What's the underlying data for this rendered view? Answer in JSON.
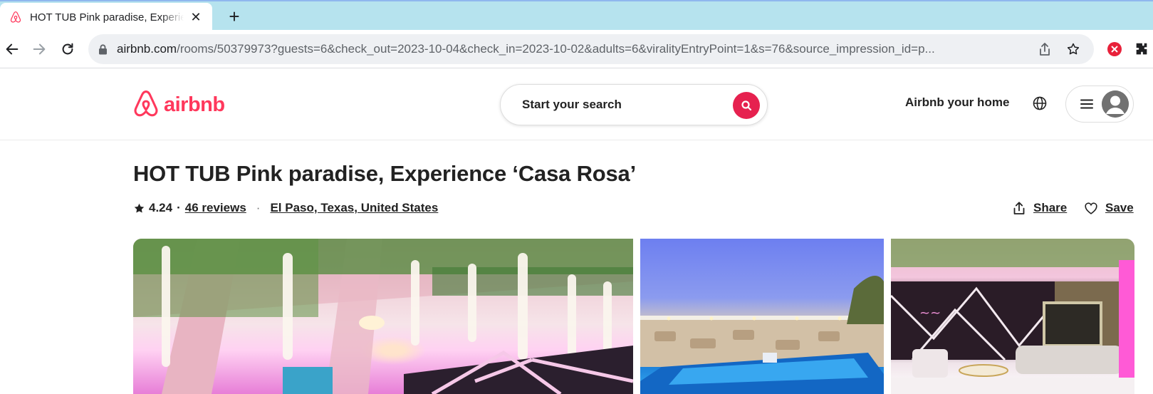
{
  "browser": {
    "tab_title": "HOT TUB Pink paradise, Experience 'Casa Rosa'",
    "tab_close": "✕",
    "new_tab": "+",
    "url_host": "airbnb.com",
    "url_path": "/rooms/50379973?guests=6&check_out=2023-10-04&check_in=2023-10-02&adults=6&viralityEntryPoint=1&s=76&source_impression_id=p..."
  },
  "header": {
    "logo_text": "airbnb",
    "search_placeholder": "Start your search",
    "host_link": "Airbnb your home"
  },
  "listing": {
    "title": "HOT TUB Pink paradise, Experience ‘Casa Rosa’",
    "rating": "4.24",
    "separator": "·",
    "reviews": "46 reviews",
    "location": "El Paso, Texas, United States",
    "share_label": "Share",
    "save_label": "Save"
  },
  "colors": {
    "brand": "#ff385c",
    "search_button": "#e6214f",
    "tabstrip": "#b6e3ee"
  },
  "icons": {
    "tab_favicon": "airbnb-logo-icon",
    "back": "arrow-left-icon",
    "forward": "arrow-right-icon",
    "reload": "reload-icon",
    "lock": "lock-icon",
    "share_page": "share-icon",
    "bookmark": "star-icon",
    "extension_1": "red-extension-icon",
    "extension_2": "puzzle-icon",
    "search": "search-icon",
    "globe": "globe-icon",
    "menu": "hamburger-icon",
    "avatar": "avatar-icon",
    "rating_star": "star-icon",
    "share": "share-icon",
    "save": "heart-icon"
  }
}
